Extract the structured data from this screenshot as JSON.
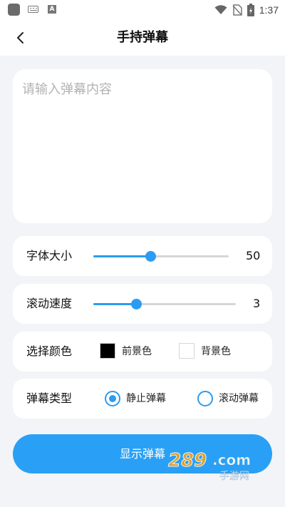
{
  "status_bar": {
    "time": "1:37",
    "icons": [
      "app-icon",
      "keyboard-icon",
      "font-icon",
      "wifi-icon",
      "no-sim-icon",
      "battery-charging-icon"
    ]
  },
  "header": {
    "back_icon": "chevron-left-icon",
    "title": "手持弹幕"
  },
  "message_input": {
    "placeholder": "请输入弹幕内容",
    "value": ""
  },
  "font_size": {
    "label": "字体大小",
    "value": "50",
    "fraction": 0.42
  },
  "scroll_speed": {
    "label": "滚动速度",
    "value": "3",
    "fraction": 0.3
  },
  "color": {
    "label": "选择颜色",
    "foreground_label": "前景色",
    "foreground_color": "#000000",
    "background_label": "背景色",
    "background_color": "#ffffff"
  },
  "barrage_type": {
    "label": "弹幕类型",
    "options": [
      {
        "label": "静止弹幕",
        "selected": true
      },
      {
        "label": "滚动弹幕",
        "selected": false
      }
    ]
  },
  "submit": {
    "label": "显示弹幕"
  },
  "watermark": {
    "text": "289.com",
    "subtext": "手游网"
  },
  "colors": {
    "accent": "#2b9cf2",
    "button": "#29a0f5",
    "page_background": "#f3f4f8"
  }
}
